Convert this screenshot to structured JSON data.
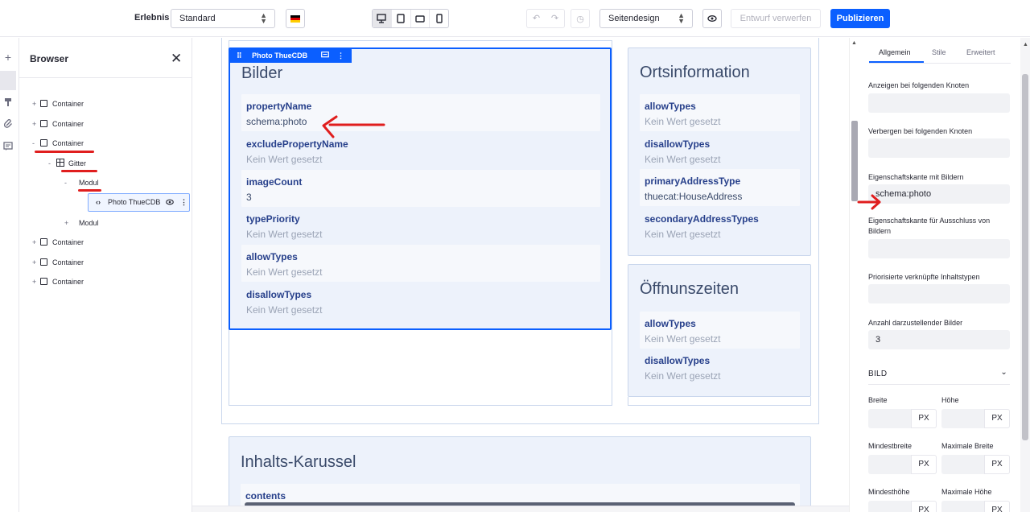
{
  "topbar": {
    "experience_label": "Erlebnis",
    "experience_value": "Standard",
    "language_flag_icon": "german-flag-icon",
    "page_design_value": "Seitendesign",
    "discard_label": "Entwurf verwerfen",
    "publish_label": "Publizieren"
  },
  "browser": {
    "title": "Browser",
    "tree": [
      {
        "label": "Container",
        "toggle": "+"
      },
      {
        "label": "Container",
        "toggle": "+"
      },
      {
        "label": "Container",
        "toggle": "-"
      },
      {
        "label": "Gitter",
        "toggle": "-"
      },
      {
        "label": "Modul",
        "toggle": "-"
      },
      {
        "label": "Photo ThueCDB"
      },
      {
        "label": "Modul",
        "toggle": "+"
      },
      {
        "label": "Container",
        "toggle": "+"
      },
      {
        "label": "Container",
        "toggle": "+"
      },
      {
        "label": "Container",
        "toggle": "+"
      }
    ]
  },
  "canvas": {
    "selected_tag": "Photo ThueCDB",
    "bilder": {
      "title": "Bilder",
      "fields": [
        {
          "name": "propertyName",
          "value": "schema:photo"
        },
        {
          "name": "excludePropertyName",
          "value": "Kein Wert gesetzt"
        },
        {
          "name": "imageCount",
          "value": "3"
        },
        {
          "name": "typePriority",
          "value": "Kein Wert gesetzt"
        },
        {
          "name": "allowTypes",
          "value": "Kein Wert gesetzt"
        },
        {
          "name": "disallowTypes",
          "value": "Kein Wert gesetzt"
        }
      ]
    },
    "ortsinformation": {
      "title": "Ortsinformation",
      "fields": [
        {
          "name": "allowTypes",
          "value": "Kein Wert gesetzt"
        },
        {
          "name": "disallowTypes",
          "value": "Kein Wert gesetzt"
        },
        {
          "name": "primaryAddressType",
          "value": "thuecat:HouseAddress"
        },
        {
          "name": "secondaryAddressTypes",
          "value": "Kein Wert gesetzt"
        }
      ]
    },
    "oeffnungszeiten": {
      "title": "Öffnunszeiten",
      "fields": [
        {
          "name": "allowTypes",
          "value": "Kein Wert gesetzt"
        },
        {
          "name": "disallowTypes",
          "value": "Kein Wert gesetzt"
        }
      ]
    },
    "karussell": {
      "title": "Inhalts-Karussel",
      "field_name": "contents"
    }
  },
  "panel": {
    "tabs": [
      "Allgemein",
      "Stile",
      "Erweitert"
    ],
    "show_nodes_label": "Anzeigen bei folgenden Knoten",
    "hide_nodes_label": "Verbergen bei folgenden Knoten",
    "image_edge_label": "Eigenschaftskante mit Bildern",
    "image_edge_value": "schema:photo",
    "exclude_edge_label": "Eigenschaftskante für Ausschluss von Bildern",
    "prioritized_label": "Priorisierte verknüpfte Inhaltstypen",
    "count_label": "Anzahl darzustellender Bilder",
    "count_value": "3",
    "section_title": "BILD",
    "width_label": "Breite",
    "height_label": "Höhe",
    "min_width_label": "Mindestbreite",
    "max_width_label": "Maximale Breite",
    "min_height_label": "Mindesthöhe",
    "max_height_label": "Maximale Höhe",
    "unit": "PX"
  },
  "annotation_color": "#e01e1e",
  "accent_color": "#0b5fff"
}
